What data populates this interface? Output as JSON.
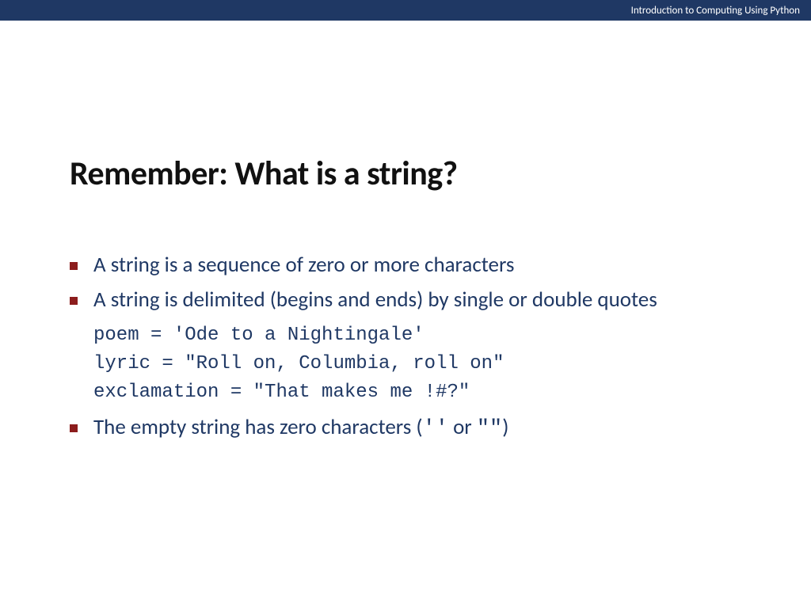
{
  "header": {
    "course_title": "Introduction to Computing Using Python"
  },
  "slide": {
    "title": "Remember: What is a string?",
    "bullets": [
      {
        "text": "A string is a sequence of zero or more characters"
      },
      {
        "text": "A string is delimited (begins and ends) by single or double quotes",
        "code": [
          "poem = 'Ode to a Nightingale'",
          "lyric = \"Roll on, Columbia, roll on\"",
          "exclamation = \"That makes me !#?\""
        ]
      },
      {
        "text_prefix": "The empty string has zero characters (",
        "text_mono": "''",
        "text_mid": " or ",
        "text_mono2": "\"\"",
        "text_suffix": ")"
      }
    ]
  }
}
